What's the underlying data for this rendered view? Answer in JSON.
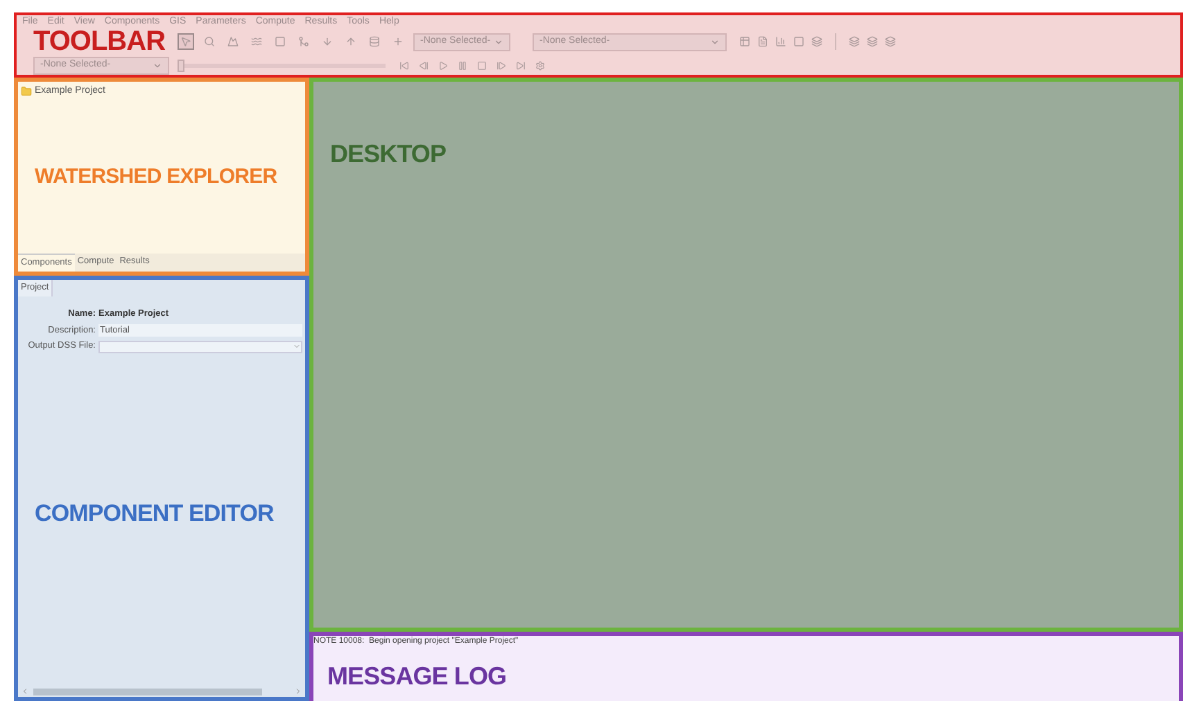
{
  "menu": [
    "File",
    "Edit",
    "View",
    "Components",
    "GIS",
    "Parameters",
    "Compute",
    "Results",
    "Tools",
    "Help"
  ],
  "toolbar": {
    "label": "TOOLBAR",
    "tools": [
      {
        "kind": "pointer",
        "selected": true
      },
      {
        "kind": "zoom",
        "selected": false
      },
      {
        "kind": "subbasin",
        "selected": false
      },
      {
        "kind": "reach",
        "selected": false
      },
      {
        "kind": "reservoir",
        "selected": false
      },
      {
        "kind": "junction",
        "selected": false
      },
      {
        "kind": "diversion",
        "selected": false
      },
      {
        "kind": "source",
        "selected": false
      },
      {
        "kind": "sink",
        "selected": false
      },
      {
        "kind": "add",
        "selected": false
      }
    ],
    "dropdown_1": "-None Selected-",
    "dropdown_2": "-None Selected-",
    "dropdown_3": "-None Selected-",
    "time_slider": {
      "level": 0
    }
  },
  "explorer": {
    "label": "WATERSHED EXPLORER",
    "tree": [
      {
        "label": "Example Project"
      }
    ],
    "tabs": [
      {
        "label": "Components",
        "selected": true
      },
      {
        "label": "Compute",
        "selected": false
      },
      {
        "label": "Results",
        "selected": false
      }
    ]
  },
  "editor": {
    "label": "COMPONENT EDITOR",
    "tab": "Project",
    "name_label": "Name:",
    "name_value": "Example Project",
    "description_label": "Description:",
    "description_value": "Tutorial",
    "dss_label": "Output DSS File:"
  },
  "desktop": {
    "label": "DESKTOP"
  },
  "message_log": {
    "label": "MESSAGE LOG",
    "messages": [
      "NOTE 10008:  Begin opening project \"Example Project\""
    ]
  }
}
